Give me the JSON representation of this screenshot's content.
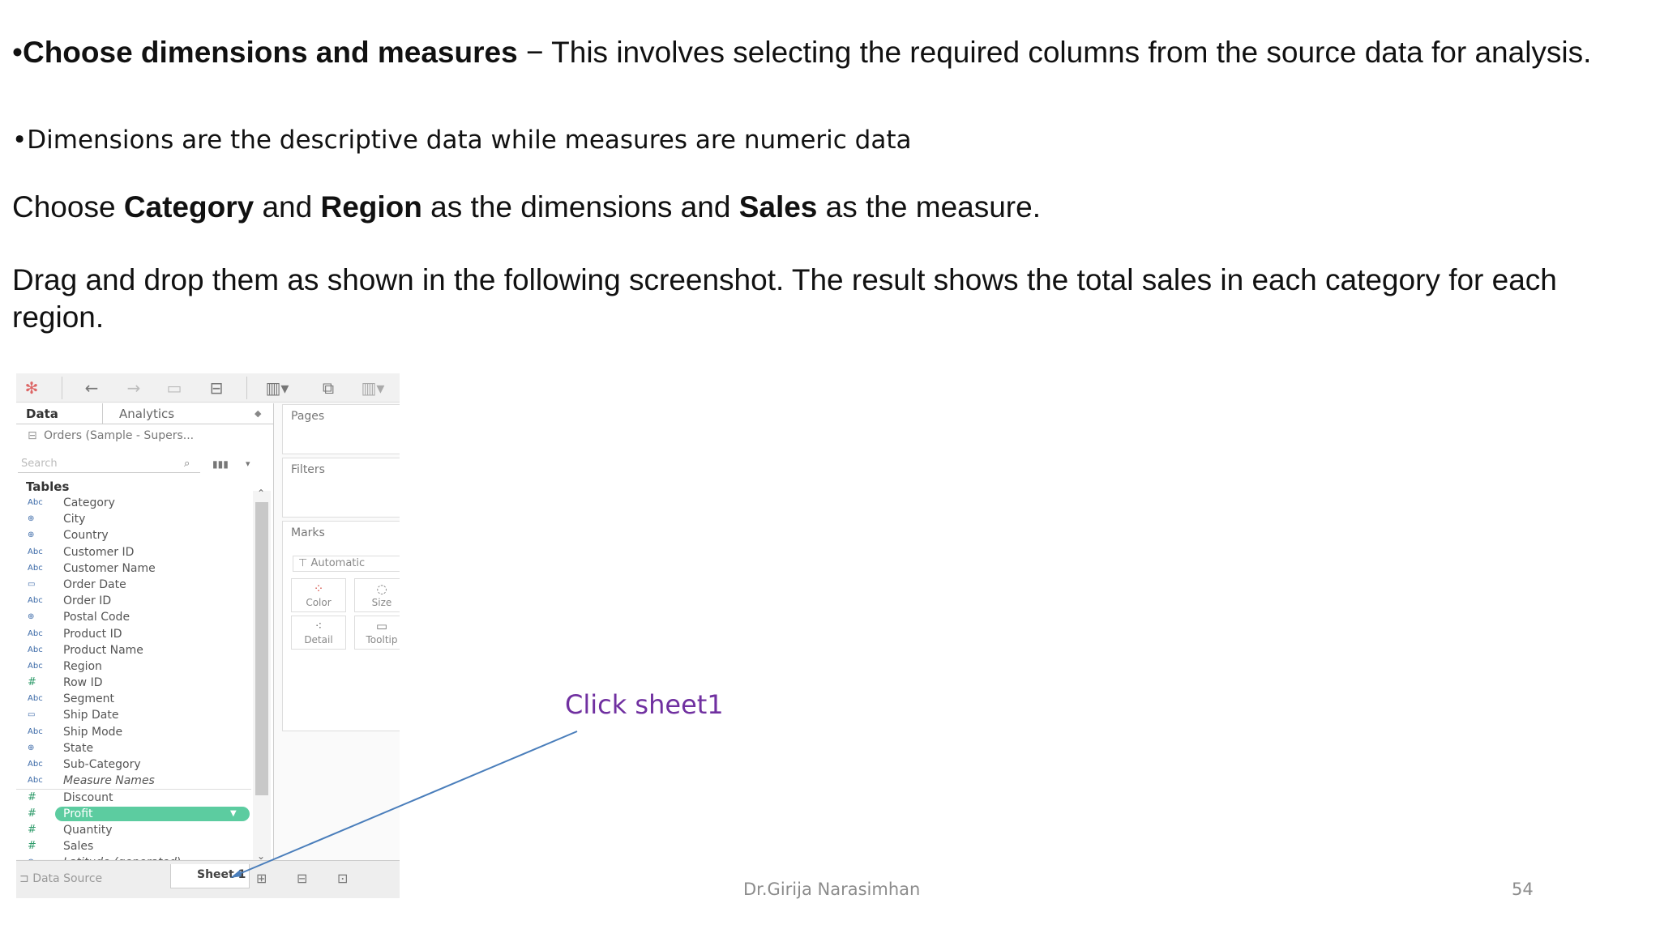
{
  "slide": {
    "p1_bullet": "•",
    "p1_bold": "Choose dimensions and measures",
    "p1_text": " − This involves selecting the required columns from the source data for analysis.",
    "p2_text": "•Dimensions are the descriptive data while measures are numeric data",
    "p3_a": "Choose ",
    "p3_b": "Category",
    "p3_c": " and ",
    "p3_d": "Region",
    "p3_e": " as the dimensions and ",
    "p3_f": "Sales",
    "p3_g": " as the measure.",
    "p4_text": "Drag and drop them as shown in the following screenshot. The result shows the total sales in each category for each region.",
    "callout": "Click sheet1",
    "author": "Dr.Girija Narasimhan",
    "page_number": "54"
  },
  "screenshot": {
    "tabs": {
      "data": "Data",
      "analytics": "Analytics"
    },
    "source": "Orders (Sample - Supers...",
    "search_placeholder": "Search",
    "tables_heading": "Tables",
    "fields": [
      {
        "type": "Abc",
        "name": "Category"
      },
      {
        "type": "⊕",
        "name": "City"
      },
      {
        "type": "⊕",
        "name": "Country"
      },
      {
        "type": "Abc",
        "name": "Customer ID"
      },
      {
        "type": "Abc",
        "name": "Customer Name"
      },
      {
        "type": "▭",
        "name": "Order Date"
      },
      {
        "type": "Abc",
        "name": "Order ID"
      },
      {
        "type": "⊕",
        "name": "Postal Code"
      },
      {
        "type": "Abc",
        "name": "Product ID"
      },
      {
        "type": "Abc",
        "name": "Product Name"
      },
      {
        "type": "Abc",
        "name": "Region"
      },
      {
        "type": "#",
        "name": "Row ID"
      },
      {
        "type": "Abc",
        "name": "Segment"
      },
      {
        "type": "▭",
        "name": "Ship Date"
      },
      {
        "type": "Abc",
        "name": "Ship Mode"
      },
      {
        "type": "⊕",
        "name": "State"
      },
      {
        "type": "Abc",
        "name": "Sub-Category"
      },
      {
        "type": "Abc",
        "name": "Measure Names"
      },
      {
        "type": "#",
        "name": "Discount"
      },
      {
        "type": "#",
        "name": "Profit"
      },
      {
        "type": "#",
        "name": "Quantity"
      },
      {
        "type": "#",
        "name": "Sales"
      },
      {
        "type": "⊕",
        "name": "Latitude (generated)"
      }
    ],
    "shelves": {
      "pages": "Pages",
      "filters": "Filters",
      "marks": "Marks"
    },
    "marks_type": "Automatic",
    "marks_buttons": {
      "color": "Color",
      "size": "Size",
      "detail": "Detail",
      "tooltip": "Tooltip"
    },
    "bottom": {
      "data_source": "Data Source",
      "sheet": "Sheet 1"
    }
  }
}
